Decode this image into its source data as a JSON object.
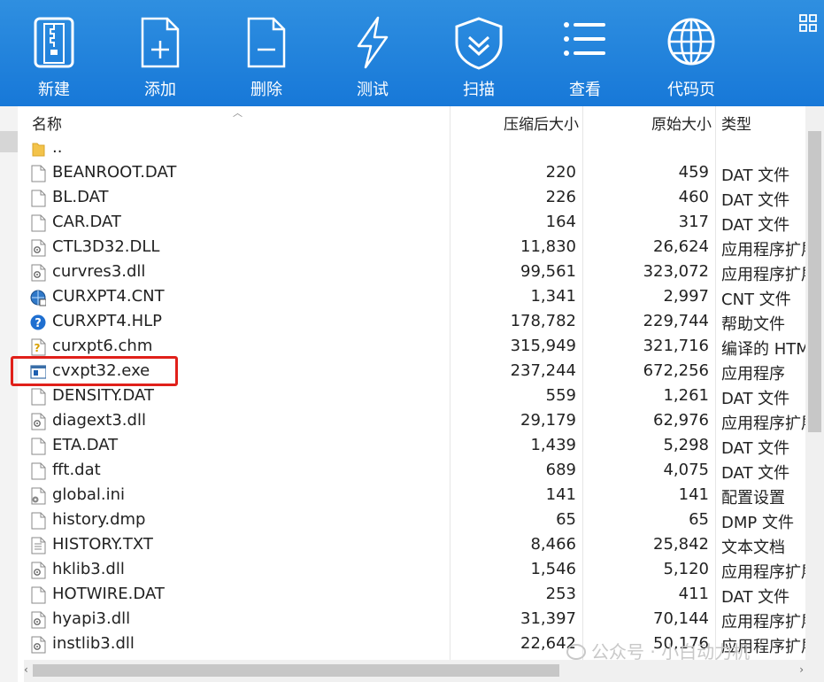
{
  "toolbar": {
    "buttons": [
      {
        "label": "新建",
        "icon": "archive-zip-icon"
      },
      {
        "label": "添加",
        "icon": "add-file-icon"
      },
      {
        "label": "删除",
        "icon": "delete-file-icon"
      },
      {
        "label": "测试",
        "icon": "lightning-icon"
      },
      {
        "label": "扫描",
        "icon": "shield-icon"
      },
      {
        "label": "查看",
        "icon": "list-view-icon"
      },
      {
        "label": "代码页",
        "icon": "globe-icon"
      }
    ],
    "grid_icon": "grid-menu-icon"
  },
  "columns": {
    "name": "名称",
    "compressed": "压缩后大小",
    "original": "原始大小",
    "type": "类型"
  },
  "files": [
    {
      "name": "..",
      "compressed": "",
      "original": "",
      "type": "",
      "icon": "folder-icon"
    },
    {
      "name": "BEANROOT.DAT",
      "compressed": "220",
      "original": "459",
      "type": "DAT 文件",
      "icon": "file-icon"
    },
    {
      "name": "BL.DAT",
      "compressed": "226",
      "original": "460",
      "type": "DAT 文件",
      "icon": "file-icon"
    },
    {
      "name": "CAR.DAT",
      "compressed": "164",
      "original": "317",
      "type": "DAT 文件",
      "icon": "file-icon"
    },
    {
      "name": "CTL3D32.DLL",
      "compressed": "11,830",
      "original": "26,624",
      "type": "应用程序扩展",
      "icon": "dll-icon"
    },
    {
      "name": "curvres3.dll",
      "compressed": "99,561",
      "original": "323,072",
      "type": "应用程序扩展",
      "icon": "dll-icon"
    },
    {
      "name": "CURXPT4.CNT",
      "compressed": "1,341",
      "original": "2,997",
      "type": "CNT 文件",
      "icon": "globe-file-icon"
    },
    {
      "name": "CURXPT4.HLP",
      "compressed": "178,782",
      "original": "229,744",
      "type": "帮助文件",
      "icon": "help-icon"
    },
    {
      "name": "curxpt6.chm",
      "compressed": "315,949",
      "original": "321,716",
      "type": "编译的 HTML",
      "icon": "chm-icon"
    },
    {
      "name": "cvxpt32.exe",
      "compressed": "237,244",
      "original": "672,256",
      "type": "应用程序",
      "icon": "exe-icon"
    },
    {
      "name": "DENSITY.DAT",
      "compressed": "559",
      "original": "1,261",
      "type": "DAT 文件",
      "icon": "file-icon"
    },
    {
      "name": "diagext3.dll",
      "compressed": "29,179",
      "original": "62,976",
      "type": "应用程序扩展",
      "icon": "dll-icon"
    },
    {
      "name": "ETA.DAT",
      "compressed": "1,439",
      "original": "5,298",
      "type": "DAT 文件",
      "icon": "file-icon"
    },
    {
      "name": "fft.dat",
      "compressed": "689",
      "original": "4,075",
      "type": "DAT 文件",
      "icon": "file-icon"
    },
    {
      "name": "global.ini",
      "compressed": "141",
      "original": "141",
      "type": "配置设置",
      "icon": "ini-icon"
    },
    {
      "name": "history.dmp",
      "compressed": "65",
      "original": "65",
      "type": "DMP 文件",
      "icon": "file-icon"
    },
    {
      "name": "HISTORY.TXT",
      "compressed": "8,466",
      "original": "25,842",
      "type": "文本文档",
      "icon": "text-file-icon"
    },
    {
      "name": "hklib3.dll",
      "compressed": "1,546",
      "original": "5,120",
      "type": "应用程序扩展",
      "icon": "dll-icon"
    },
    {
      "name": "HOTWIRE.DAT",
      "compressed": "253",
      "original": "411",
      "type": "DAT 文件",
      "icon": "file-icon"
    },
    {
      "name": "hyapi3.dll",
      "compressed": "31,397",
      "original": "70,144",
      "type": "应用程序扩展",
      "icon": "dll-icon"
    },
    {
      "name": "instlib3.dll",
      "compressed": "22,642",
      "original": "50,176",
      "type": "应用程序扩展",
      "icon": "dll-icon"
    }
  ],
  "watermark": "公众号 · 小白动力机",
  "colors": {
    "toolbar": "#1778d8",
    "highlight": "#e0201a"
  }
}
